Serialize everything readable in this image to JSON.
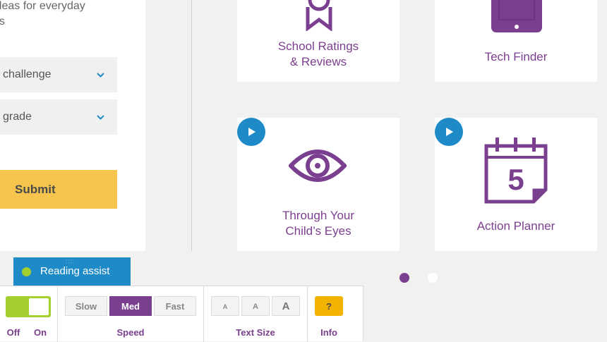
{
  "form": {
    "intro_line1": "ideas for everyday",
    "intro_line2": "es",
    "challenge_select": "challenge",
    "grade_select": "grade",
    "submit_label": "Submit"
  },
  "tools": [
    {
      "label": "School Ratings\n& Reviews",
      "icon": "ribbon-award-icon",
      "has_video": false
    },
    {
      "label": "Tech Finder",
      "icon": "tablet-icon",
      "has_video": false
    },
    {
      "label": "Through Your\nChild’s Eyes",
      "icon": "eye-icon",
      "has_video": true
    },
    {
      "label": "Action Planner",
      "icon": "calendar-icon",
      "has_video": true,
      "calendar_day": "5"
    }
  ],
  "carousel": {
    "active_page": 1,
    "total_pages": 2
  },
  "reading_assist": {
    "tab_label": "Reading assist",
    "toggle": {
      "off_label": "Off",
      "on_label": "On",
      "state": "on"
    },
    "speed": {
      "label": "Speed",
      "options": [
        "Slow",
        "Med",
        "Fast"
      ],
      "selected": "Med"
    },
    "text_size": {
      "label": "Text Size",
      "options": [
        "A",
        "A",
        "A"
      ]
    },
    "info": {
      "label": "Info",
      "button": "?"
    }
  },
  "colors": {
    "accent_purple": "#7b3f8f",
    "accent_blue": "#1e8ac7",
    "submit_yellow": "#f5c54e",
    "toggle_green": "#a3cf2f",
    "info_orange": "#f2b300"
  }
}
